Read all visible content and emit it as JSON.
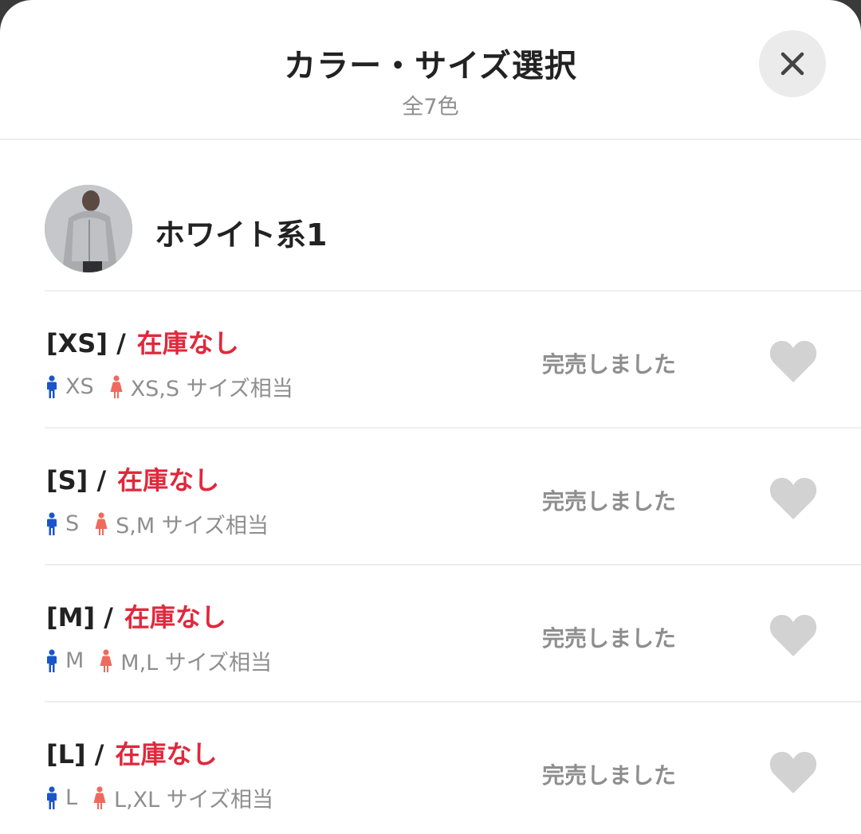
{
  "header": {
    "title": "カラー・サイズ選択",
    "subtitle": "全7色"
  },
  "close_icon": "close-icon",
  "color": {
    "name": "ホワイト系1",
    "thumbnail": "model-photo"
  },
  "colors": {
    "stock_red": "#e0283c",
    "male_blue": "#1a56c9",
    "female_pink": "#ef6a5c",
    "heart_gray": "#d2d2d2"
  },
  "sizes": [
    {
      "size_label": "[XS] /",
      "stock": "在庫なし",
      "male_size": "XS",
      "female_size": "XS,S サイズ相当",
      "status": "完売しました"
    },
    {
      "size_label": "[S] /",
      "stock": "在庫なし",
      "male_size": "S",
      "female_size": "S,M サイズ相当",
      "status": "完売しました"
    },
    {
      "size_label": "[M] /",
      "stock": "在庫なし",
      "male_size": "M",
      "female_size": "M,L サイズ相当",
      "status": "完売しました"
    },
    {
      "size_label": "[L] /",
      "stock": "在庫なし",
      "male_size": "L",
      "female_size": "L,XL サイズ相当",
      "status": "完売しました"
    }
  ]
}
